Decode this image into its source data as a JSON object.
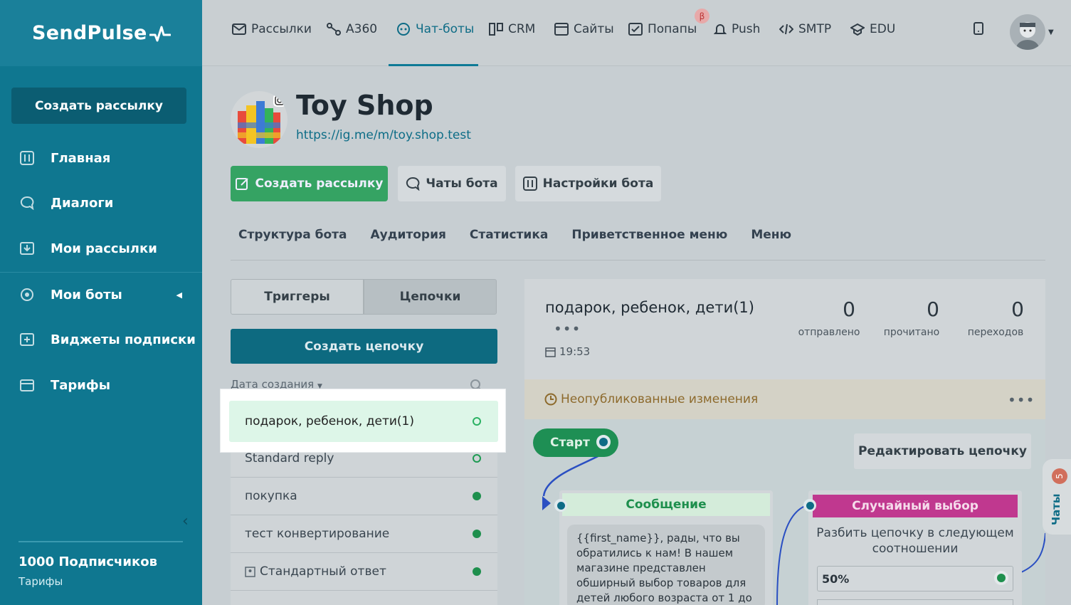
{
  "brand": "SendPulse",
  "sidebar": {
    "create_label": "Создать рассылку",
    "items": [
      {
        "label": "Главная",
        "icon": "dashboard-icon"
      },
      {
        "label": "Диалоги",
        "icon": "chat-icon"
      },
      {
        "label": "Мои рассылки",
        "icon": "mailings-icon"
      },
      {
        "label": "Мои боты",
        "icon": "bots-icon"
      },
      {
        "label": "Виджеты подписки",
        "icon": "widget-icon"
      },
      {
        "label": "Тарифы",
        "icon": "wallet-icon"
      }
    ],
    "footer_title": "1000 Подписчиков",
    "footer_sub": "Тарифы"
  },
  "topnav": {
    "items": [
      {
        "label": "Рассылки",
        "icon": "mail-icon"
      },
      {
        "label": "A360",
        "icon": "automation-icon"
      },
      {
        "label": "Чат-боты",
        "icon": "chatbot-icon",
        "active": true
      },
      {
        "label": "CRM",
        "icon": "crm-icon"
      },
      {
        "label": "Сайты",
        "icon": "site-icon"
      },
      {
        "label": "Попапы",
        "icon": "popup-icon"
      },
      {
        "label": "Push",
        "icon": "bell-icon"
      },
      {
        "label": "SMTP",
        "icon": "code-icon"
      },
      {
        "label": "EDU",
        "icon": "graduation-icon"
      }
    ],
    "beta_badge": "β"
  },
  "bot": {
    "name": "Toy Shop",
    "link": "https://ig.me/m/toy.shop.test"
  },
  "actions": {
    "create": "Создать рассылку",
    "chats": "Чаты бота",
    "settings": "Настройки бота"
  },
  "tabs": [
    "Структура бота",
    "Аудитория",
    "Статистика",
    "Приветственное меню",
    "Меню"
  ],
  "segments": {
    "triggers": "Триггеры",
    "chains": "Цепочки"
  },
  "create_chain": "Создать цепочку",
  "sort_label": "Дата создания",
  "chains": [
    {
      "name": "подарок, ребенок, дети(1)",
      "status": "draft"
    },
    {
      "name": "Standard reply",
      "status": "draft"
    },
    {
      "name": "покупка",
      "status": "active"
    },
    {
      "name": "тест конвертирование",
      "status": "active"
    },
    {
      "name": "Стандартный ответ",
      "status": "active"
    }
  ],
  "detail": {
    "title": "подарок, ребенок, дети(1)",
    "time": "19:53",
    "stats": [
      {
        "value": "0",
        "label": "отправлено"
      },
      {
        "value": "0",
        "label": "прочитано"
      },
      {
        "value": "0",
        "label": "переходов"
      }
    ],
    "unpublished": "Неопубликованные изменения",
    "start": "Старт",
    "edit": "Редактировать цепочку",
    "message_node": "Сообщение",
    "message_text": "{{first_name}}, рады, что вы обратились к нам! В нашем магазине представлен обширный выбор товаров для детей любого возраста от 1 до",
    "random_node": "Случайный выбор",
    "random_text": "Разбить цепочку в следующем соотношении",
    "random_pct": "50%"
  },
  "chats_tab": {
    "label": "Чаты",
    "badge": "5"
  },
  "colors": {
    "accent": "#0f7790",
    "green": "#35a363",
    "random": "#c0388f"
  }
}
